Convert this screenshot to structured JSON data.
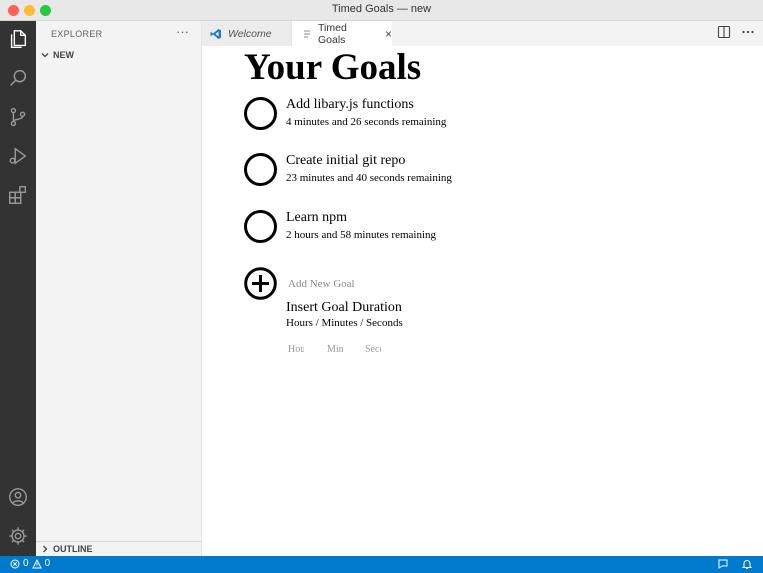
{
  "window": {
    "title": "Timed Goals — new"
  },
  "activity_bar": {
    "items": [
      "explorer-icon",
      "search-icon",
      "source-control-icon",
      "run-debug-icon",
      "extensions-icon"
    ],
    "bottom": [
      "account-icon",
      "settings-gear-icon"
    ]
  },
  "sidebar": {
    "title": "EXPLORER",
    "more": "···",
    "folder": "NEW",
    "outline": "OUTLINE"
  },
  "tabs": [
    {
      "label": "Welcome",
      "icon": "vscode-logo-icon"
    },
    {
      "label": "Timed Goals",
      "icon": "document-icon",
      "close": "×"
    }
  ],
  "editor": {
    "heading": "Your Goals",
    "goals": [
      {
        "name": "Add libary.js functions",
        "remaining": "4 minutes and 26 seconds remaining"
      },
      {
        "name": "Create initial git repo",
        "remaining": "23 minutes and 40 seconds remaining"
      },
      {
        "name": "Learn npm",
        "remaining": "2 hours and 58 minutes remaining"
      }
    ],
    "add_goal_placeholder": "Add New Goal",
    "duration_title": "Insert Goal Duration",
    "duration_subtitle": "Hours / Minutes / Seconds",
    "hours_placeholder": "Hours",
    "minutes_placeholder": "Minutes",
    "seconds_placeholder": "Seconds"
  },
  "status_bar": {
    "errors": "0",
    "warnings": "0"
  },
  "colors": {
    "status_bar": "#007acc",
    "activity_bar": "#333333"
  }
}
